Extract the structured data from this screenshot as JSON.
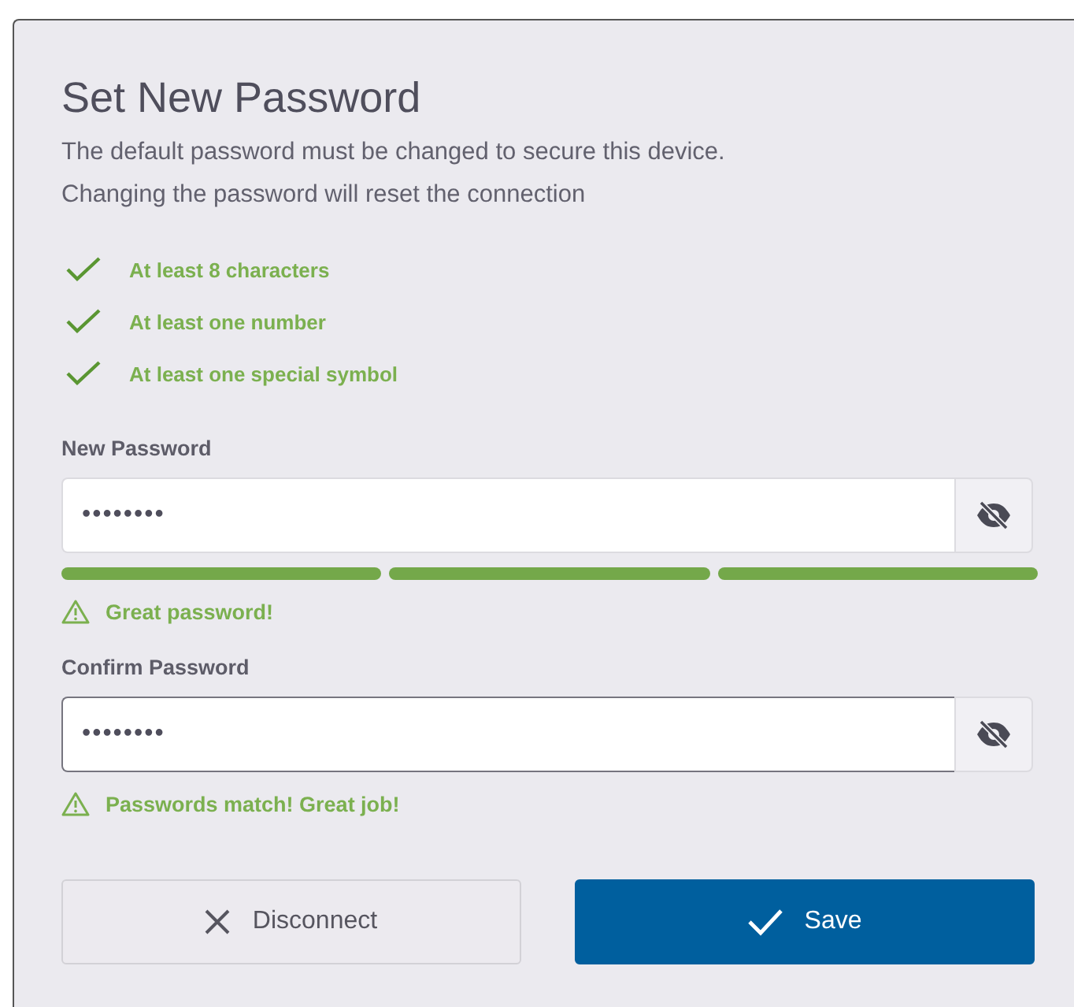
{
  "title": "Set New Password",
  "description": [
    "The default password must be changed to secure this device.",
    "Changing the password will reset the connection"
  ],
  "rules": [
    {
      "label": "At least 8 characters",
      "met": true
    },
    {
      "label": "At least one number",
      "met": true
    },
    {
      "label": "At least one special symbol",
      "met": true
    }
  ],
  "new_password": {
    "label": "New Password",
    "value": "••••••••",
    "focused": false,
    "strength": [
      {
        "filled": true
      },
      {
        "filled": true
      },
      {
        "filled": true
      }
    ],
    "message": "Great password!"
  },
  "confirm_password": {
    "label": "Confirm Password",
    "value": "••••••••",
    "focused": true,
    "message": "Passwords match! Great job!"
  },
  "buttons": [
    {
      "label": "Disconnect",
      "kind": "secondary"
    },
    {
      "label": "Save",
      "kind": "primary"
    }
  ]
}
